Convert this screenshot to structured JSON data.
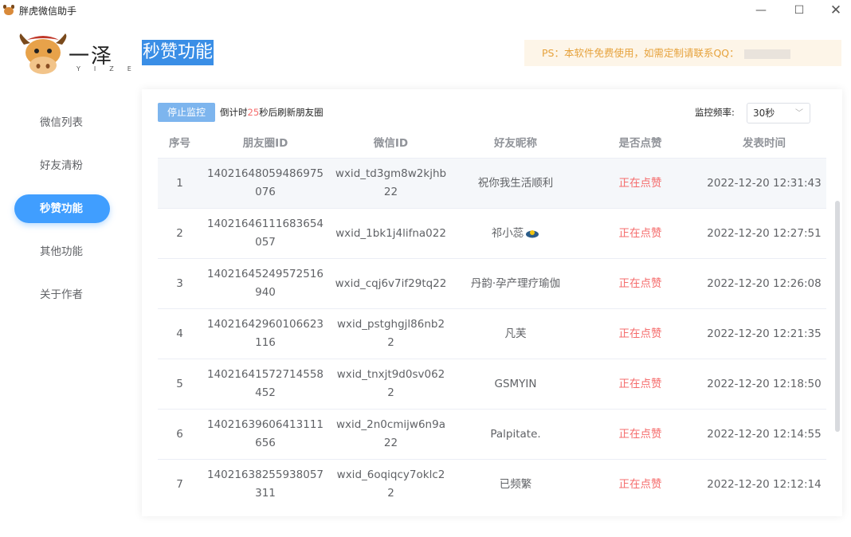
{
  "window": {
    "title": "胖虎微信助手",
    "controls": {
      "minimize": "—",
      "maximize": "☐",
      "close": "✕"
    }
  },
  "brand": {
    "logo_text": "一泽",
    "logo_sub": "YIZE"
  },
  "header": {
    "page_title": "秒赞功能",
    "notice": "PS：本软件免费使用，如需定制请联系QQ："
  },
  "sidebar": {
    "items": [
      {
        "label": "微信列表",
        "active": false
      },
      {
        "label": "好友清粉",
        "active": false
      },
      {
        "label": "秒赞功能",
        "active": true
      },
      {
        "label": "其他功能",
        "active": false
      },
      {
        "label": "关于作者",
        "active": false
      }
    ]
  },
  "toolbar": {
    "stop_label": "停止监控",
    "countdown_prefix": "倒计时",
    "countdown_value": "25",
    "countdown_suffix": "秒后刷新朋友圈",
    "freq_label": "监控频率:",
    "freq_value": "30秒"
  },
  "table": {
    "headers": [
      "序号",
      "朋友圈ID",
      "微信ID",
      "好友昵称",
      "是否点赞",
      "发表时间"
    ],
    "rows": [
      {
        "no": "1",
        "moment_id": "14021648059486975076",
        "wxid": "wxid_td3gm8w2kjhb22",
        "nickname": "祝你我生活顺利",
        "status": "正在点赞",
        "time": "2022-12-20 12:31:43"
      },
      {
        "no": "2",
        "moment_id": "14021646111683654057",
        "wxid": "wxid_1bk1j4lifna022",
        "nickname": "祁小蕊",
        "status": "正在点赞",
        "time": "2022-12-20 12:27:51"
      },
      {
        "no": "3",
        "moment_id": "14021645249572516940",
        "wxid": "wxid_cqj6v7if29tq22",
        "nickname": "丹韵·孕产理疗瑜伽",
        "status": "正在点赞",
        "time": "2022-12-20 12:26:08"
      },
      {
        "no": "4",
        "moment_id": "14021642960106623116",
        "wxid": "wxid_pstghgjl86nb22",
        "nickname": "凡芙",
        "status": "正在点赞",
        "time": "2022-12-20 12:21:35"
      },
      {
        "no": "5",
        "moment_id": "14021641572714558452",
        "wxid": "wxid_tnxjt9d0sv0622",
        "nickname": "GSMYIN",
        "status": "正在点赞",
        "time": "2022-12-20 12:18:50"
      },
      {
        "no": "6",
        "moment_id": "14021639606413111656",
        "wxid": "wxid_2n0cmijw6n9a22",
        "nickname": "Palpitate.",
        "status": "正在点赞",
        "time": "2022-12-20 12:14:55"
      },
      {
        "no": "7",
        "moment_id": "14021638255938057311",
        "wxid": "wxid_6oqiqcy7oklc22",
        "nickname": "已频繁",
        "status": "正在点赞",
        "time": "2022-12-20 12:12:14"
      }
    ]
  },
  "colors": {
    "accent": "#409eff",
    "liked": "#f56c6c",
    "notice_bg": "#fdf5e8",
    "notice_text": "#e6a23c"
  }
}
